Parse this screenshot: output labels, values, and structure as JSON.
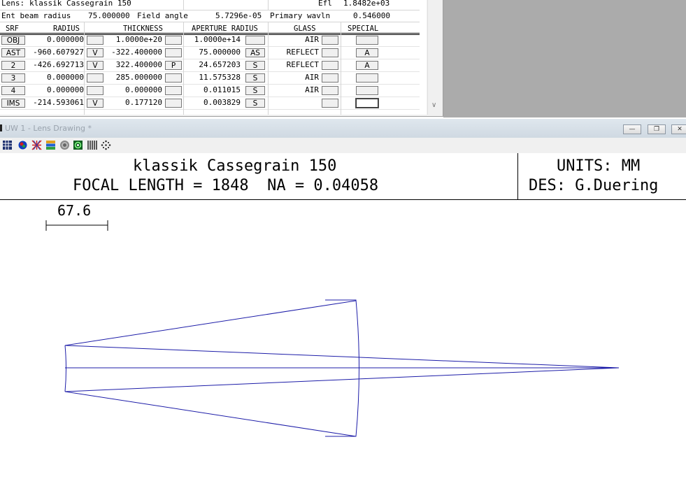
{
  "sheet": {
    "line1": {
      "lens_label": "Lens:",
      "lens_name": "klassik Cassegrain 150",
      "efl_label": "Efl",
      "efl_value": "1.8482e+03"
    },
    "line2": {
      "ebr_label": "Ent beam radius",
      "ebr_value": "75.000000",
      "fa_label": "Field angle",
      "fa_value": "5.7296e-05",
      "pw_label": "Primary wavln",
      "pw_value": "0.546000"
    },
    "headers": [
      "SRF",
      "RADIUS",
      "THICKNESS",
      "APERTURE RADIUS",
      "GLASS",
      "SPECIAL"
    ],
    "rows": [
      {
        "srf": "OBJ",
        "radius": "0.000000",
        "rflag": "",
        "thickness": "1.0000e+20",
        "tflag": "",
        "aperture": "1.0000e+14",
        "aflag": "",
        "glass": "AIR",
        "special": ""
      },
      {
        "srf": "AST",
        "radius": "-960.607927",
        "rflag": "V",
        "thickness": "-322.400000",
        "tflag": "",
        "aperture": "75.000000",
        "aflag": "AS",
        "glass": "REFLECT",
        "special": "A"
      },
      {
        "srf": "2",
        "radius": "-426.692713",
        "rflag": "V",
        "thickness": "322.400000",
        "tflag": "P",
        "aperture": "24.657203",
        "aflag": "S",
        "glass": "REFLECT",
        "special": "A"
      },
      {
        "srf": "3",
        "radius": "0.000000",
        "rflag": "",
        "thickness": "285.000000",
        "tflag": "",
        "aperture": "11.575328",
        "aflag": "S",
        "glass": "AIR",
        "special": ""
      },
      {
        "srf": "4",
        "radius": "0.000000",
        "rflag": "",
        "thickness": "0.000000",
        "tflag": "",
        "aperture": "0.011015",
        "aflag": "S",
        "glass": "AIR",
        "special": ""
      },
      {
        "srf": "IMS",
        "radius": "-214.593061",
        "rflag": "V",
        "thickness": "0.177120",
        "tflag": "",
        "aperture": "0.003829",
        "aflag": "S",
        "glass": "",
        "special": ""
      }
    ]
  },
  "lens_window": {
    "title": "UW 1 - Lens Drawing *",
    "toolbar_icons": [
      "grid-icon",
      "globe-icon",
      "spot-icon",
      "layers-icon",
      "target-icon",
      "psf-icon",
      "bars-icon",
      "dots-icon"
    ],
    "header_left_line1": "klassik Cassegrain 150",
    "header_left_line2": "FOCAL LENGTH = 1848  NA = 0.04058",
    "header_right_line1": "UNITS: MM",
    "header_right_line2": "DES: G.Duering",
    "scale_label": "67.6"
  },
  "colors": {
    "ray": "#1c1ca8",
    "window_gray": "#ababab"
  }
}
